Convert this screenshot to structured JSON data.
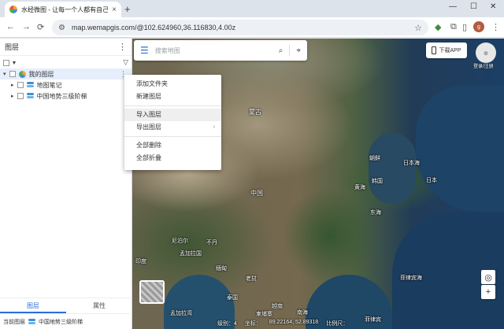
{
  "browser": {
    "tab_title": "水经微图 - 让每一个人都有自己",
    "tab_close": "×",
    "new_tab": "+",
    "minimize": "—",
    "maximize": "☐",
    "close": "✕",
    "url": "map.wemapgis.com/@102.624960,36.116830,4.00z",
    "back": "←",
    "forward": "→",
    "reload": "⟳",
    "profile_initial": "g"
  },
  "panel": {
    "title": "图层",
    "more": "⋮",
    "tree": [
      {
        "label": "我的图层",
        "selected": true
      },
      {
        "label": "地图笔记"
      },
      {
        "label": "中国地势三级阶梯"
      }
    ],
    "tabs": [
      "图层",
      "属性"
    ],
    "status_prefix": "当前图层",
    "status_layer": "中国地势三级阶梯"
  },
  "search": {
    "placeholder": "搜索地图"
  },
  "header_right": {
    "download_label": "下载APP",
    "login_label": "登录/注册"
  },
  "context_menu": {
    "items": [
      "添加文件夹",
      "新建图层",
      "导入图层",
      "导出图层",
      "全部删除",
      "全部折叠"
    ],
    "submenu_arrow": "›"
  },
  "map_labels": [
    {
      "text": "蒙古"
    },
    {
      "text": "朝鲜"
    },
    {
      "text": "日本海"
    },
    {
      "text": "黄海"
    },
    {
      "text": "韩国"
    },
    {
      "text": "日本"
    },
    {
      "text": "中国"
    },
    {
      "text": "东海"
    },
    {
      "text": "尼泊尔"
    },
    {
      "text": "不丹"
    },
    {
      "text": "印度"
    },
    {
      "text": "孟加拉国"
    },
    {
      "text": "缅甸"
    },
    {
      "text": "老挝"
    },
    {
      "text": "泰国"
    },
    {
      "text": "柬埔寨"
    },
    {
      "text": "越南"
    },
    {
      "text": "菲律宾海"
    },
    {
      "text": "菲律宾"
    },
    {
      "text": "孟加拉湾"
    },
    {
      "text": "南海"
    }
  ],
  "statusbar": {
    "zoom_text": "级别：4",
    "coord_label": "坐标：",
    "coords": "89.22164, 52.89318",
    "scale_label": "比例尺："
  },
  "map_controls": {
    "locate": "◎",
    "zoom_in": "+"
  }
}
